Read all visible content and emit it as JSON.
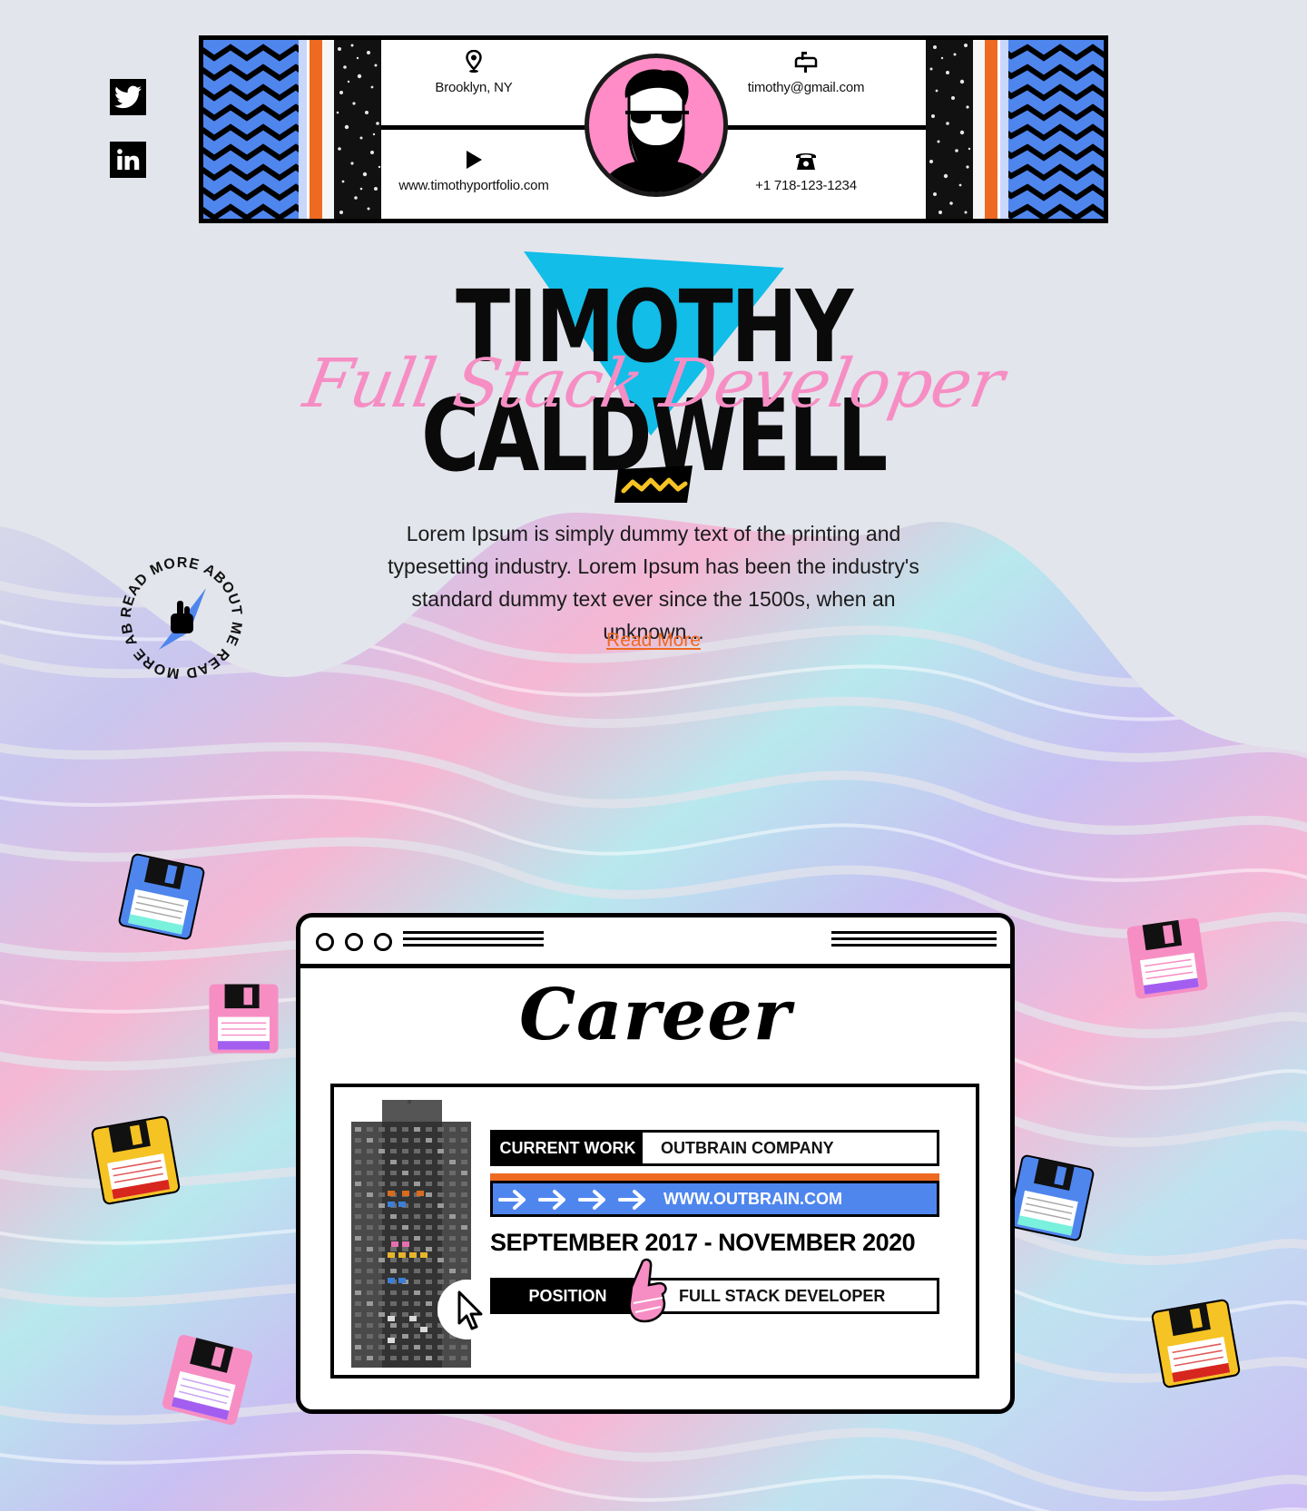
{
  "social": {
    "twitter_icon": "twitter-icon",
    "linkedin_icon": "linkedin-icon"
  },
  "header": {
    "location": "Brooklyn, NY",
    "email": "timothy@gmail.com",
    "website": "www.timothyportfolio.com",
    "phone": "+1 718-123-1234",
    "icons": [
      "map-pin-icon",
      "mailbox-icon",
      "play-icon",
      "telephone-icon"
    ]
  },
  "hero": {
    "name": "TIMOTHY CALDWELL",
    "subtitle": "Full Stack Developer",
    "about": "Lorem Ipsum is simply dummy text of the printing and typesetting industry. Lorem Ipsum has been the industry's standard dummy text ever since the 1500s, when an unknown...",
    "read_more": "Read More",
    "badge_text": "READ MORE ABOUT ME READ MORE ABOUT ME"
  },
  "career": {
    "title": "Career",
    "current_work_label": "CURRENT WORK",
    "company": "OUTBRAIN COMPANY",
    "url": "WWW.OUTBRAIN.COM",
    "dates": "SEPTEMBER 2017 - NOVEMBER 2020",
    "position_label": "POSITION",
    "position": "FULL STACK DEVELOPER"
  },
  "colors": {
    "accent_pink": "#f68ec4",
    "accent_blue": "#4f86ee",
    "accent_orange": "#ee6a22",
    "accent_cyan": "#12bde8",
    "accent_yellow": "#f6c324"
  }
}
